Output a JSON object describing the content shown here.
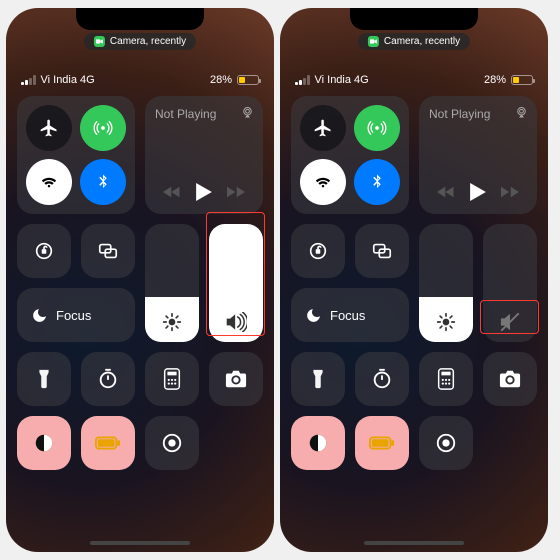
{
  "screens": [
    {
      "volumeLevel": 100,
      "volumeMuted": false,
      "highlightVolume": true,
      "highlightH": 124
    },
    {
      "volumeLevel": 0,
      "volumeMuted": true,
      "highlightVolume": true,
      "highlightH": 36
    }
  ],
  "pill": {
    "label": "Camera, recently"
  },
  "status": {
    "carrier": "Vi India 4G",
    "batteryPercent": "28%",
    "batteryFill": 28,
    "signalBars": [
      3,
      5,
      7,
      10
    ],
    "signalActive": 2
  },
  "media": {
    "notPlaying": "Not Playing"
  },
  "focus": {
    "label": "Focus"
  },
  "brightness": {
    "level": 38
  },
  "colors": {}
}
